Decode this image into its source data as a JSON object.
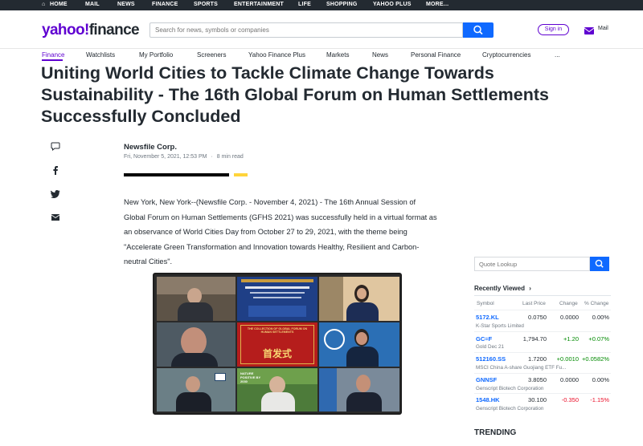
{
  "topbar": {
    "items": [
      "HOME",
      "MAIL",
      "NEWS",
      "FINANCE",
      "SPORTS",
      "ENTERTAINMENT",
      "LIFE",
      "SHOPPING",
      "YAHOO PLUS",
      "MORE..."
    ]
  },
  "header": {
    "logo_yahoo": "yahoo!",
    "logo_finance": "finance",
    "search_placeholder": "Search for news, symbols or companies",
    "signin": "Sign in",
    "mail": "Mail"
  },
  "nav": {
    "items": [
      "Finance",
      "Watchlists",
      "My Portfolio",
      "Screeners",
      "Yahoo Finance Plus",
      "Markets",
      "News",
      "Personal Finance",
      "Cryptocurrencies",
      "..."
    ]
  },
  "article": {
    "title": "Uniting World Cities to Tackle Climate Change Towards Sustainability - The 16th Global Forum on Human Settlements Successfully Concluded",
    "author": "Newsfile Corp.",
    "date": "Fri, November 5, 2021, 12:53 PM",
    "dot": "·",
    "read_time": "8 min read",
    "body": "New York, New York--(Newsfile Corp. - November 4, 2021) - The 16th Annual Session of Global Forum on Human Settlements (GFHS 2021) was successfully held in a virtual format as an observance of World Cities Day from October 27 to 29, 2021, with the theme being \"Accelerate Green Transformation and Innovation towards Healthy, Resilient and Carbon-neutral Cities\"."
  },
  "sidebar": {
    "quote_placeholder": "Quote Lookup",
    "recently_viewed": "Recently Viewed",
    "columns": [
      "Symbol",
      "Last Price",
      "Change",
      "% Change"
    ],
    "rows": [
      {
        "symbol": "5172.KL",
        "name": "K-Star Sports Limited",
        "price": "0.0750",
        "change": "0.0000",
        "pct": "0.00%",
        "dir": "flat"
      },
      {
        "symbol": "GC=F",
        "name": "Gold Dec 21",
        "price": "1,794.70",
        "change": "+1.20",
        "pct": "+0.07%",
        "dir": "up"
      },
      {
        "symbol": "512160.SS",
        "name": "MSCI China A-share Guojiang ETF Fu...",
        "price": "1.7200",
        "change": "+0.0010",
        "pct": "+0.0582%",
        "dir": "up"
      },
      {
        "symbol": "GNNSF",
        "name": "Genscript Biotech Corporation",
        "price": "3.8050",
        "change": "0.0000",
        "pct": "0.00%",
        "dir": "flat"
      },
      {
        "symbol": "1548.HK",
        "name": "Genscript Biotech Corporation",
        "price": "30.100",
        "change": "-0.350",
        "pct": "-1.15%",
        "dir": "down"
      }
    ],
    "trending": "TRENDING"
  },
  "photo": {
    "banner_text": "THE COLLECTION OF GLOBAL FORUM ON HUMAN SETTLEMENTS",
    "chinese_text": "首发式",
    "nature_text": "NATURE POSITIVE BY 2030"
  }
}
